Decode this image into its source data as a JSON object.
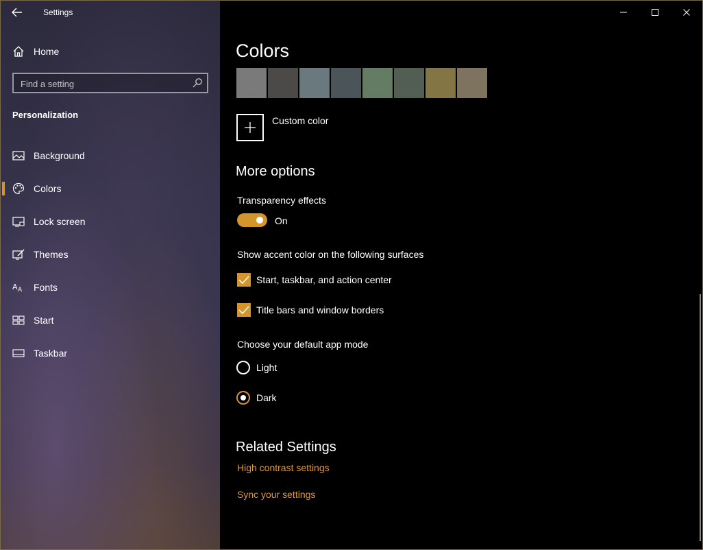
{
  "window": {
    "title": "Settings"
  },
  "sidebar": {
    "home_label": "Home",
    "search_placeholder": "Find a setting",
    "section_title": "Personalization",
    "items": [
      {
        "label": "Background",
        "icon": "picture-icon"
      },
      {
        "label": "Colors",
        "icon": "palette-icon",
        "active": true
      },
      {
        "label": "Lock screen",
        "icon": "lock-screen-icon"
      },
      {
        "label": "Themes",
        "icon": "themes-icon"
      },
      {
        "label": "Fonts",
        "icon": "fonts-icon"
      },
      {
        "label": "Start",
        "icon": "start-icon"
      },
      {
        "label": "Taskbar",
        "icon": "taskbar-icon"
      }
    ]
  },
  "main": {
    "title": "Colors",
    "swatch_colors": [
      "#7a7a7a",
      "#4c4a48",
      "#69797e",
      "#4a5459",
      "#647c64",
      "#525e54",
      "#847545",
      "#7e735f"
    ],
    "custom_color_label": "Custom color",
    "more_options_title": "More options",
    "transparency": {
      "label": "Transparency effects",
      "state": "On"
    },
    "accent_surfaces": {
      "label": "Show accent color on the following surfaces",
      "options": [
        {
          "label": "Start, taskbar, and action center",
          "checked": true
        },
        {
          "label": "Title bars and window borders",
          "checked": true
        }
      ]
    },
    "app_mode": {
      "label": "Choose your default app mode",
      "options": [
        {
          "label": "Light",
          "selected": false
        },
        {
          "label": "Dark",
          "selected": true
        }
      ]
    },
    "related": {
      "title": "Related Settings",
      "links": [
        "High contrast settings",
        "Sync your settings"
      ]
    }
  },
  "colors": {
    "accent": "#d4952c",
    "link": "#e0973a",
    "background": "#000000"
  }
}
